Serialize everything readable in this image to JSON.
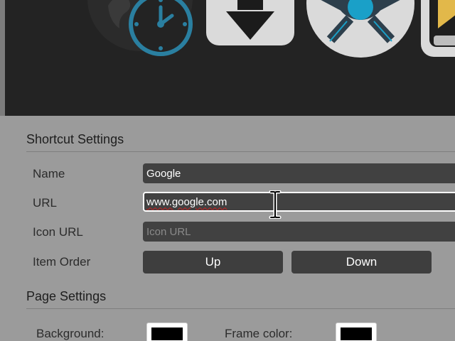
{
  "shortcuts": [
    {
      "name": "Clock",
      "icon": "globe-clock-icon",
      "accent": "#2a7fa0"
    },
    {
      "name": "Download",
      "icon": "download-arrow-icon",
      "accent": "#dadada"
    },
    {
      "name": "Hub",
      "icon": "hub-network-icon",
      "accent": "#1aa0c8"
    },
    {
      "name": "Folder",
      "icon": "partial-yellow-icon",
      "accent": "#e2b84a"
    }
  ],
  "shortcut_settings": {
    "title": "Shortcut Settings",
    "name_label": "Name",
    "name_value": "Google",
    "url_label": "URL",
    "url_value": "www.google.com",
    "icon_url_label": "Icon URL",
    "icon_url_placeholder": "Icon URL",
    "item_order_label": "Item Order",
    "up_label": "Up",
    "down_label": "Down"
  },
  "page_settings": {
    "title": "Page Settings",
    "background_label": "Background:",
    "background_color": "#000000",
    "frame_color_label": "Frame color:",
    "frame_color": "#000000"
  },
  "colors": {
    "panel_bg": "#9b9b9b",
    "dark_bg": "#232323",
    "input_bg": "#414141",
    "button_bg": "#3e3e3e"
  }
}
